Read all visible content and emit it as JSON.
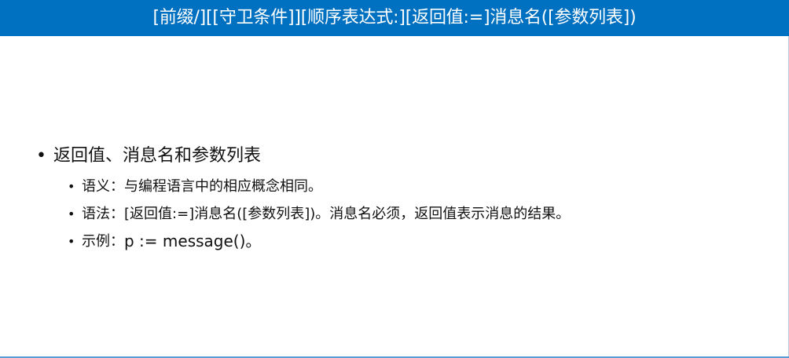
{
  "title": "[前缀/][[守卫条件]][顺序表达式:][返回值:=]消息名([参数列表])",
  "main_bullet": {
    "bullet": "•",
    "text": "返回值、消息名和参数列表"
  },
  "sub_items": [
    {
      "bullet": "•",
      "label": "语义：",
      "text": "与编程语言中的相应概念相同。"
    },
    {
      "bullet": "•",
      "label": "语法：",
      "text": "[返回值:=]消息名([参数列表])。消息名必须，返回值表示消息的结果。"
    },
    {
      "bullet": "•",
      "label": "示例：",
      "text": "p := message()。"
    }
  ],
  "colors": {
    "title_bar": "#0070c0",
    "title_text": "#ffffff",
    "body_text": "#111111",
    "bottom_line": "#5b9bd5"
  }
}
